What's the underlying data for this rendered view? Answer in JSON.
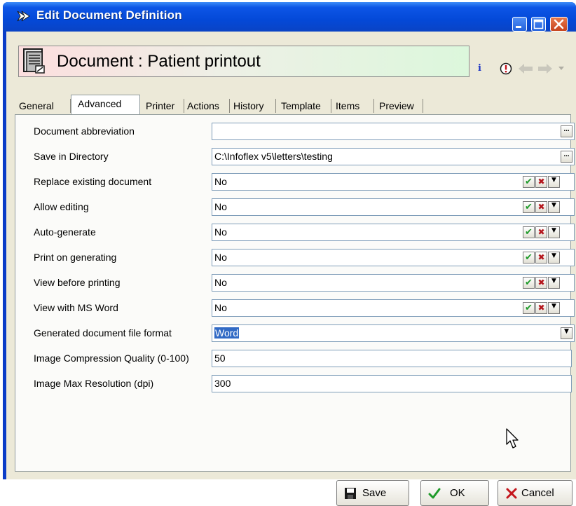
{
  "window": {
    "title": "Edit Document Definition",
    "controls": [
      "minimize-icon",
      "maximize-icon",
      "close-icon"
    ]
  },
  "header": {
    "title": "Document : Patient printout",
    "icons": [
      "document-icon",
      "info-icon",
      "alert-icon",
      "back-arrow-icon",
      "forward-arrow-icon",
      "chevron-down-icon"
    ]
  },
  "tabs": [
    "General",
    "Advanced",
    "Printer",
    "Actions",
    "History",
    "Template",
    "Items",
    "Preview"
  ],
  "active_tab": "Advanced",
  "fields": [
    {
      "label": "Document abbreviation",
      "value": ""
    },
    {
      "label": "Save in Directory",
      "value": "C:\\Infoflex v5\\letters\\testing"
    },
    {
      "label": "Replace existing document",
      "value": "No"
    },
    {
      "label": "Allow editing",
      "value": "No"
    },
    {
      "label": "Auto-generate",
      "value": "No"
    },
    {
      "label": "Print on generating",
      "value": "No"
    },
    {
      "label": "View before printing",
      "value": "No"
    },
    {
      "label": "View with MS Word",
      "value": "No"
    },
    {
      "label": "Generated document file format",
      "value": "Word"
    },
    {
      "label": "Image Compression Quality (0-100)",
      "value": "50"
    },
    {
      "label": "Image Max Resolution (dpi)",
      "value": "300"
    }
  ],
  "footer": {
    "save": "Save",
    "ok": "OK",
    "cancel": "Cancel"
  },
  "colors": {
    "titlebar": "#0449d8",
    "selection": "#316ac5",
    "check": "#1f9a2a",
    "cross": "#b4161d"
  }
}
